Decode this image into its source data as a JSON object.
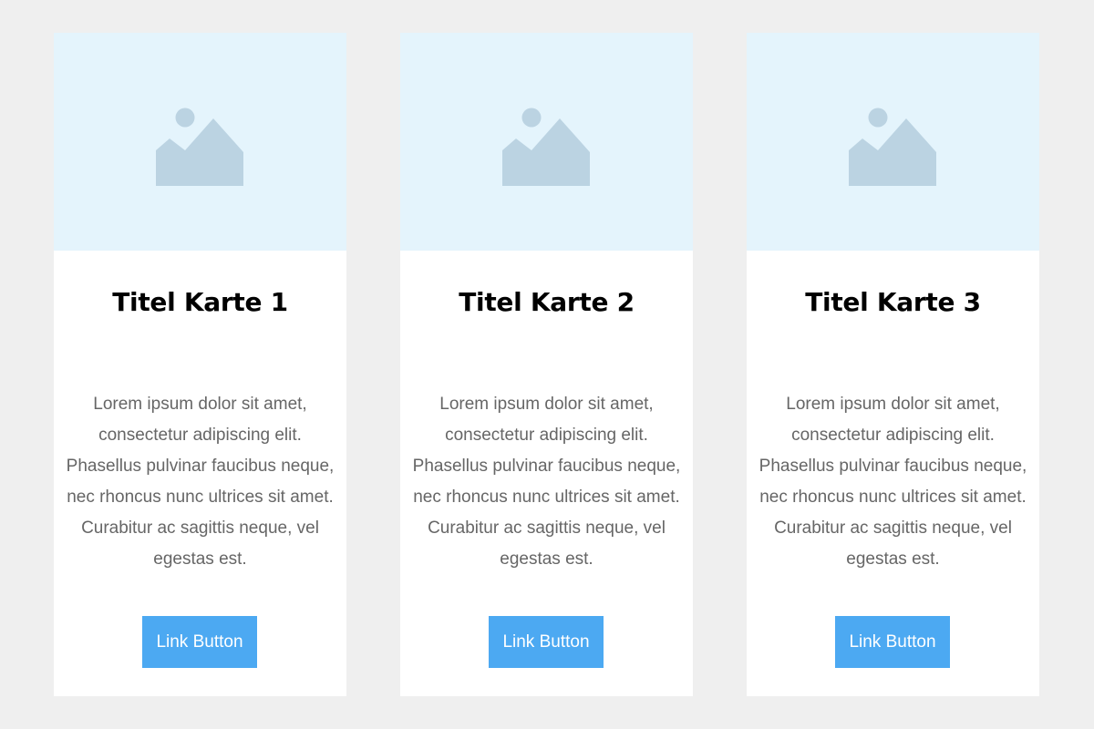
{
  "colors": {
    "page_background": "#efefef",
    "card_background": "#ffffff",
    "image_background": "#e4f4fc",
    "icon_color": "#bbd3e2",
    "title_color": "#000000",
    "text_color": "#666666",
    "button_background": "#4ca9f2",
    "button_text": "#ffffff"
  },
  "cards": [
    {
      "image_icon": "image-placeholder-icon",
      "title": "Titel Karte 1",
      "text": "Lorem ipsum dolor sit amet, consectetur adipiscing elit. Phasellus pulvinar faucibus neque, nec rhoncus nunc ultrices sit amet. Curabitur ac sagittis neque, vel egestas est.",
      "button_label": "Link Button"
    },
    {
      "image_icon": "image-placeholder-icon",
      "title": "Titel Karte 2",
      "text": "Lorem ipsum dolor sit amet, consectetur adipiscing elit. Phasellus pulvinar faucibus neque, nec rhoncus nunc ultrices sit amet. Curabitur ac sagittis neque, vel egestas est.",
      "button_label": "Link Button"
    },
    {
      "image_icon": "image-placeholder-icon",
      "title": "Titel Karte 3",
      "text": "Lorem ipsum dolor sit amet, consectetur adipiscing elit. Phasellus pulvinar faucibus neque, nec rhoncus nunc ultrices sit amet. Curabitur ac sagittis neque, vel egestas est.",
      "button_label": "Link Button"
    }
  ]
}
